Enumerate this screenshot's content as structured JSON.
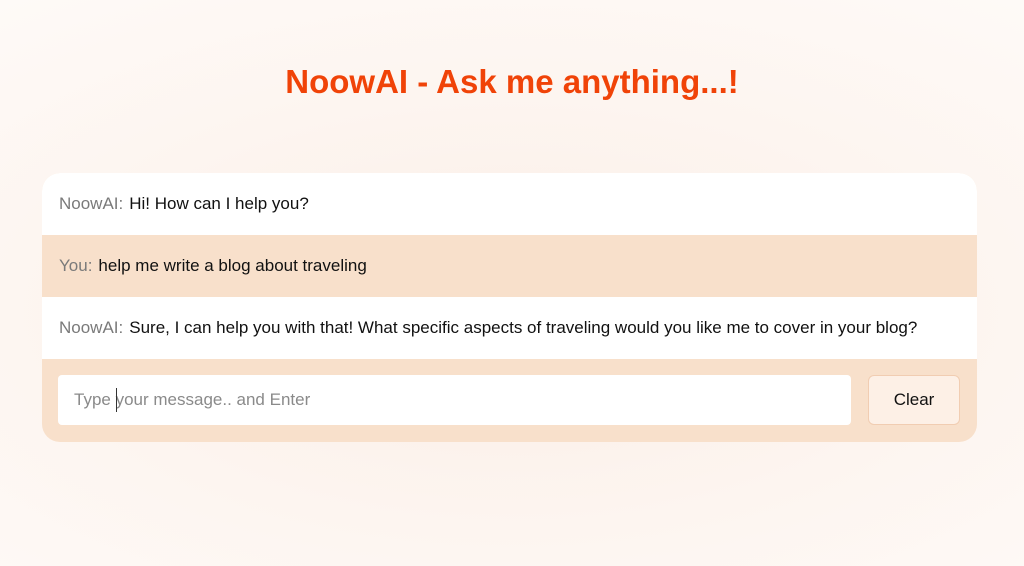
{
  "header": {
    "title": "NoowAI - Ask me anything...!"
  },
  "chat": {
    "messages": [
      {
        "sender": "NoowAI:",
        "role": "bot",
        "text": "Hi! How can I help you?"
      },
      {
        "sender": "You:",
        "role": "user",
        "text": "help me write a blog about traveling"
      },
      {
        "sender": "NoowAI:",
        "role": "bot",
        "text": "Sure, I can help you with that! What specific aspects of traveling would you like me to cover in your blog?"
      }
    ]
  },
  "composer": {
    "placeholder": "Type your message.. and Enter",
    "value": "",
    "clear_label": "Clear"
  },
  "colors": {
    "title": "#f04308",
    "user_row": "#f8e0cb",
    "bot_row": "#ffffff"
  }
}
